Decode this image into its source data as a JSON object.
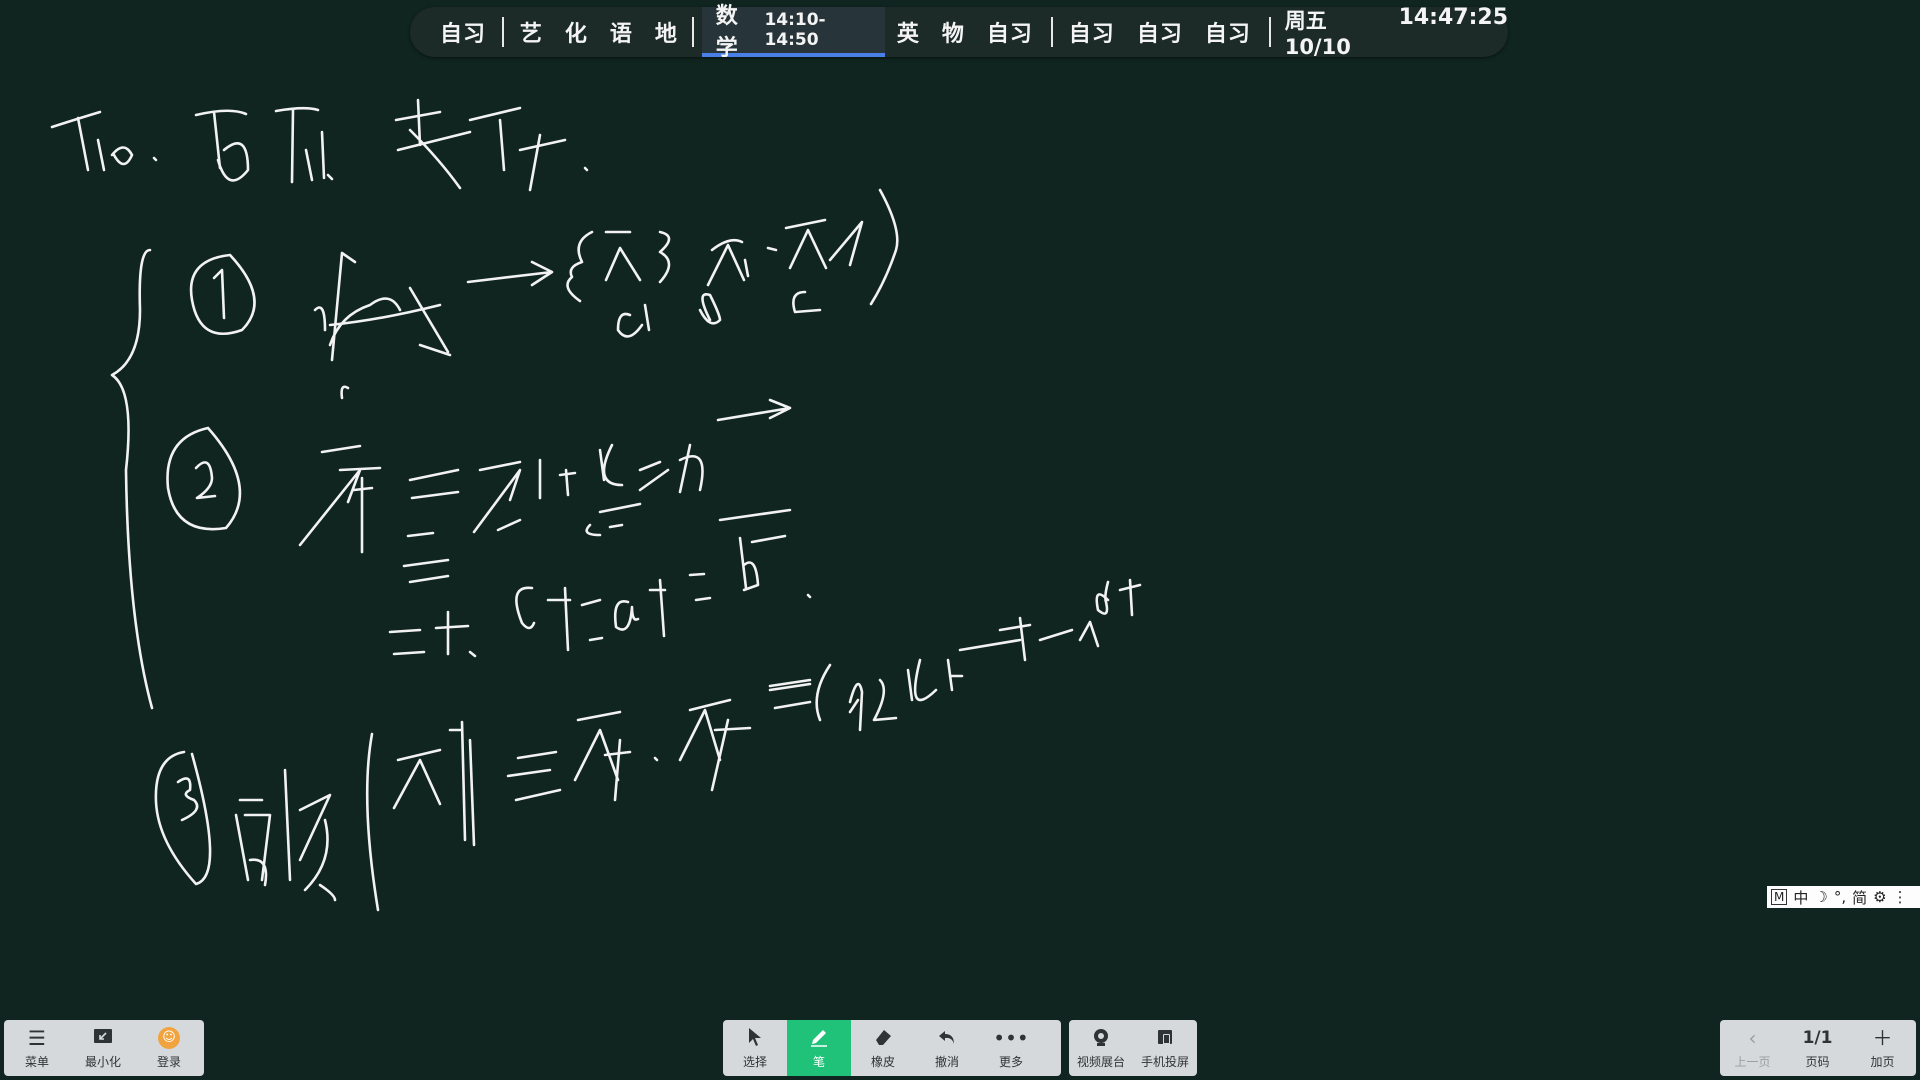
{
  "schedule": {
    "group1": [
      "自习"
    ],
    "group2": [
      "艺",
      "化",
      "语",
      "地"
    ],
    "current": {
      "subject": "数学",
      "time": "14:10-14:50"
    },
    "group3": [
      "英",
      "物",
      "自习"
    ],
    "group4": [
      "自习",
      "自习",
      "自习"
    ],
    "date": "周五 10/10",
    "clock": "14:47:25"
  },
  "ime": {
    "logo": "M",
    "items": [
      "中",
      "☽",
      "°,",
      "简",
      "⚙",
      "⋮"
    ]
  },
  "left_toolbar": [
    {
      "label": "菜单",
      "icon": "menu-icon"
    },
    {
      "label": "最小化",
      "icon": "minimize-icon"
    },
    {
      "label": "登录",
      "icon": "avatar-icon"
    }
  ],
  "center_toolbar": [
    {
      "label": "选择",
      "icon": "cursor-icon"
    },
    {
      "label": "笔",
      "icon": "pen-icon",
      "active": true
    },
    {
      "label": "橡皮",
      "icon": "eraser-icon"
    },
    {
      "label": "撤消",
      "icon": "undo-icon"
    },
    {
      "label": "更多",
      "icon": "more-icon"
    }
  ],
  "media_toolbar": [
    {
      "label": "视频展台",
      "icon": "camera-icon"
    },
    {
      "label": "手机投屏",
      "icon": "phone-cast-icon"
    }
  ],
  "page_toolbar": {
    "prev": {
      "label": "上一页",
      "icon": "chevron-left-icon"
    },
    "page": {
      "value": "1/1",
      "label": "页码"
    },
    "add": {
      "label": "加页",
      "icon": "plus-icon"
    }
  },
  "colors": {
    "board": "#10251f",
    "active": "#20c27a",
    "accent": "#4a7fe6"
  }
}
